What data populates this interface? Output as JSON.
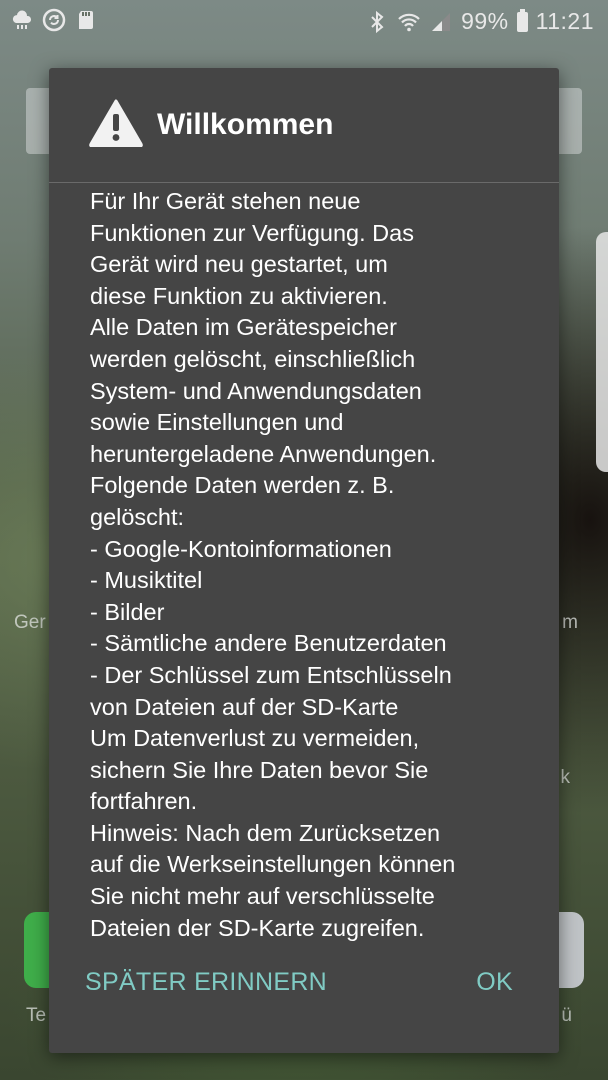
{
  "status_bar": {
    "battery_percent": "99%",
    "time": "11:21",
    "left_icons": [
      "weather-icon",
      "sync-icon",
      "sd-card-icon"
    ],
    "right_icons": [
      "bluetooth-icon",
      "wifi-icon",
      "signal-icon",
      "battery-icon"
    ]
  },
  "background": {
    "left_label_1": "Ger",
    "right_label_1": "m",
    "right_label_2": "k",
    "left_label_2": "Te",
    "right_label_3": "ü"
  },
  "dialog": {
    "title": "Willkommen",
    "icon": "warning-icon",
    "body_lines": [
      "Für Ihr Gerät stehen neue",
      "Funktionen zur Verfügung. Das",
      "Gerät wird neu gestartet, um",
      "diese Funktion zu aktivieren.",
      "Alle Daten im Gerätespeicher",
      "werden gelöscht, einschließlich",
      "System- und Anwendungsdaten",
      "sowie Einstellungen und",
      "heruntergeladene Anwendungen.",
      "Folgende Daten werden z. B.",
      "gelöscht:",
      "- Google-Kontoinformationen",
      "- Musiktitel",
      "- Bilder",
      "- Sämtliche andere Benutzerdaten",
      "- Der Schlüssel zum Entschlüsseln",
      "von Dateien auf der SD-Karte",
      "Um Datenverlust zu vermeiden,",
      "sichern Sie Ihre Daten bevor Sie",
      "fortfahren.",
      "Hinweis: Nach dem Zurücksetzen",
      "auf die Werkseinstellungen können",
      "Sie nicht mehr auf verschlüsselte",
      "Dateien der SD-Karte zugreifen."
    ],
    "later_label": "SPÄTER ERINNERN",
    "ok_label": "OK",
    "accent_color": "#80cbc4"
  }
}
